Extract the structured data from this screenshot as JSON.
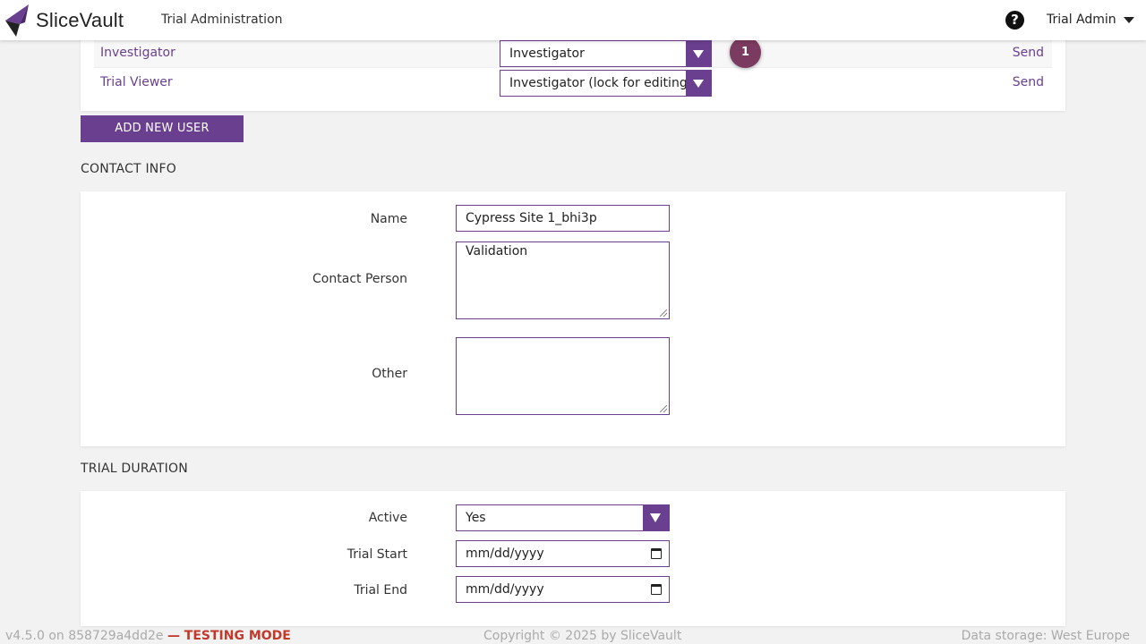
{
  "header": {
    "logo_text": "SliceVault",
    "app_title": "Trial Administration",
    "help_icon": "?",
    "user_name": "Trial Admin"
  },
  "users": [
    {
      "name": "Investigator",
      "role": "Investigator",
      "action": "Send"
    },
    {
      "name": "Trial Viewer",
      "role": "Investigator (lock for editing)",
      "action": "Send"
    }
  ],
  "step_badge": "1",
  "add_user_button": "ADD NEW USER",
  "contact_info": {
    "title": "CONTACT INFO",
    "name_label": "Name",
    "name_value": "Cypress Site 1_bhi3p",
    "contact_label": "Contact Person",
    "contact_value": "Validation",
    "other_label": "Other",
    "other_value": ""
  },
  "trial_duration": {
    "title": "TRIAL DURATION",
    "active_label": "Active",
    "active_value": "Yes",
    "start_label": "Trial Start",
    "start_value": "mm/dd/yyyy",
    "end_label": "Trial End",
    "end_value": "mm/dd/yyyy"
  },
  "footer": {
    "version": "v4.5.0 on 858729a4dd2e",
    "mode": "— TESTING MODE",
    "copyright": "Copyright © 2025 by SliceVault",
    "storage": "Data storage: West Europe"
  },
  "colors": {
    "accent": "#6a3f8f",
    "badge": "#7b3a5f"
  }
}
